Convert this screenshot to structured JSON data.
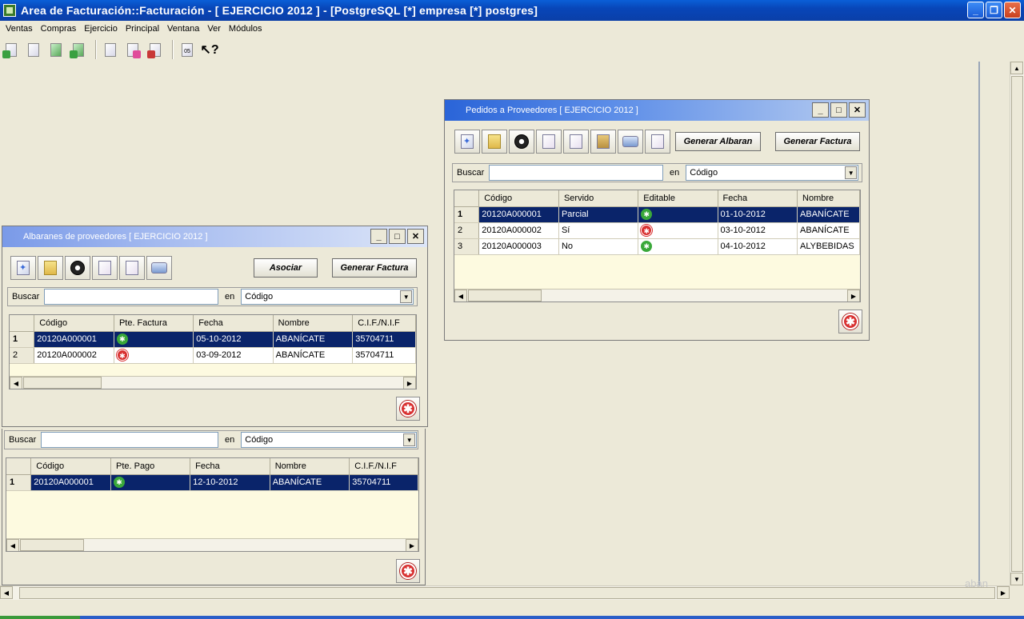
{
  "window": {
    "title": "Area de Facturación::Facturación  - [ EJERCICIO 2012 ] - [PostgreSQL [*] empresa [*] postgres]"
  },
  "menu": [
    "Ventas",
    "Compras",
    "Ejercicio",
    "Principal",
    "Ventana",
    "Ver",
    "Módulos"
  ],
  "watermark": "aban",
  "pedidos": {
    "title": "Pedidos a Proveedores [ EJERCICIO 2012 ]",
    "btn_albaran": "Generar Albaran",
    "btn_factura": "Generar Factura",
    "search_label": "Buscar",
    "search_value": "",
    "en": "en",
    "select": "Código",
    "columns": [
      "Código",
      "Servido",
      "Editable",
      "Fecha",
      "Nombre"
    ],
    "rows": [
      {
        "n": "1",
        "codigo": "20120A000001",
        "servido": "Parcial",
        "editable": "ok",
        "fecha": "01-10-2012",
        "nombre": "ABANÍCATE"
      },
      {
        "n": "2",
        "codigo": "20120A000002",
        "servido": "Sí",
        "editable": "no",
        "fecha": "03-10-2012",
        "nombre": "ABANÍCATE"
      },
      {
        "n": "3",
        "codigo": "20120A000003",
        "servido": "No",
        "editable": "ok",
        "fecha": "04-10-2012",
        "nombre": "ALYBEBIDAS"
      }
    ]
  },
  "albaranes": {
    "title": "Albaranes de proveedores [ EJERCICIO 2012 ]",
    "btn_asociar": "Asociar",
    "btn_factura": "Generar Factura",
    "search_label": "Buscar",
    "search_value": "",
    "en": "en",
    "select": "Código",
    "columns": [
      "Código",
      "Pte. Factura",
      "Fecha",
      "Nombre",
      "C.I.F./N.I.F"
    ],
    "rows": [
      {
        "n": "1",
        "codigo": "20120A000001",
        "pte": "ok",
        "fecha": "05-10-2012",
        "nombre": "ABANÍCATE",
        "cif": "35704711"
      },
      {
        "n": "2",
        "codigo": "20120A000002",
        "pte": "no",
        "fecha": "03-09-2012",
        "nombre": "ABANÍCATE",
        "cif": "35704711"
      }
    ]
  },
  "facturas": {
    "search_label": "Buscar",
    "search_value": "",
    "en": "en",
    "select": "Código",
    "columns": [
      "Código",
      "Pte. Pago",
      "Fecha",
      "Nombre",
      "C.I.F./N.I.F"
    ],
    "rows": [
      {
        "n": "1",
        "codigo": "20120A000001",
        "pte": "ok",
        "fecha": "12-10-2012",
        "nombre": "ABANÍCATE",
        "cif": "35704711"
      }
    ]
  }
}
